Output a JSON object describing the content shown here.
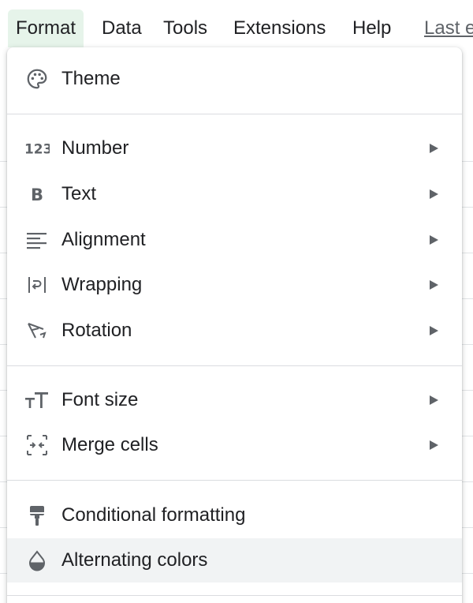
{
  "menubar": {
    "tabs": [
      {
        "label": "Format",
        "active": true
      },
      {
        "label": "Data"
      },
      {
        "label": "Tools"
      },
      {
        "label": "Extensions"
      },
      {
        "label": "Help"
      }
    ],
    "last_edit": "Last e"
  },
  "format_menu": {
    "items": [
      {
        "label": "Theme",
        "icon": "palette-icon",
        "submenu": false
      },
      {
        "label": "Number",
        "icon": "number-123-icon",
        "submenu": true
      },
      {
        "label": "Text",
        "icon": "bold-icon",
        "submenu": true
      },
      {
        "label": "Alignment",
        "icon": "align-left-icon",
        "submenu": true
      },
      {
        "label": "Wrapping",
        "icon": "text-wrap-icon",
        "submenu": true
      },
      {
        "label": "Rotation",
        "icon": "text-rotation-icon",
        "submenu": true
      },
      {
        "label": "Font size",
        "icon": "font-size-icon",
        "submenu": true
      },
      {
        "label": "Merge cells",
        "icon": "merge-cells-icon",
        "submenu": true
      },
      {
        "label": "Conditional formatting",
        "icon": "paint-roller-icon",
        "submenu": false
      },
      {
        "label": "Alternating colors",
        "icon": "color-drop-icon",
        "submenu": false,
        "highlighted": true
      }
    ]
  },
  "colors": {
    "active_tab_bg": "#e6f4ea",
    "hover_bg": "#f1f3f4",
    "icon": "#5f6368",
    "text": "#202124",
    "separator": "#dadce0"
  }
}
